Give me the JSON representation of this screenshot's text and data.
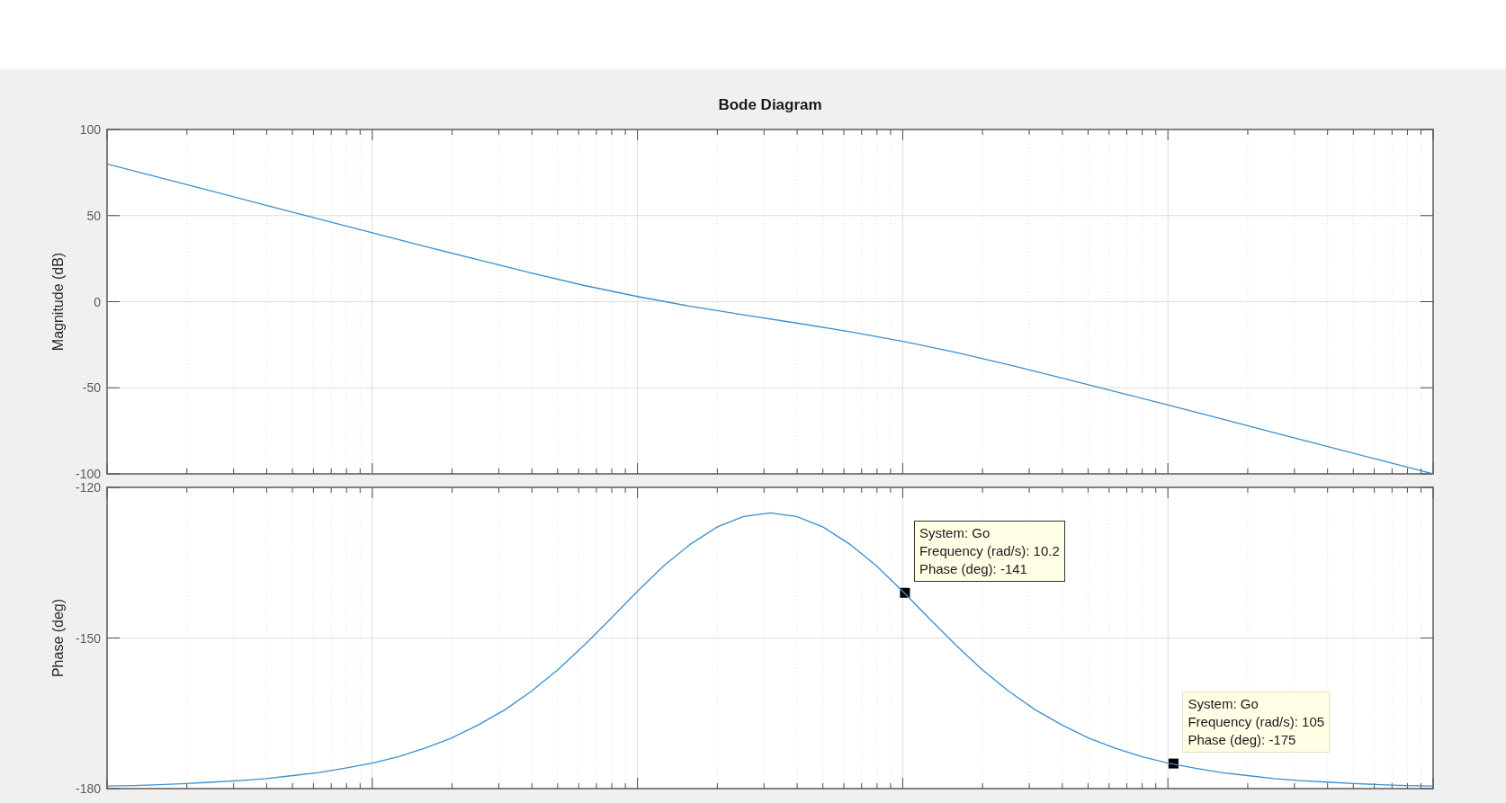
{
  "figure": {
    "title": "Bode Diagram"
  },
  "magnitude_plot": {
    "chart_data": {
      "type": "line",
      "grid": true,
      "ylabel": "Magnitude (dB)",
      "ylim": [
        -100,
        100
      ],
      "yticks": [
        -100,
        -50,
        0,
        50,
        100
      ],
      "categories": [
        null,
        null,
        null,
        null,
        null,
        null,
        null,
        null,
        null,
        null,
        null,
        null,
        null,
        null,
        null,
        null,
        null,
        null,
        null,
        null,
        null,
        null,
        null,
        null,
        null,
        null
      ],
      "series": [
        {
          "color": "#3b8fd0",
          "values": [
            80,
            72,
            64,
            56,
            48,
            40,
            32.1,
            24.3,
            16.6,
            9.4,
            3,
            -2.7,
            -7.6,
            -12.4,
            -17.4,
            -23,
            -29.4,
            -36.6,
            -44.3,
            -52.1,
            -60,
            -68,
            -76,
            -84,
            -92,
            -100
          ]
        }
      ]
    }
  },
  "phase_plot": {
    "chart_data": {
      "type": "line",
      "grid": true,
      "ylabel": "Phase (deg)",
      "ylim": [
        -180,
        -120
      ],
      "yticks": [
        -180,
        -150,
        -120
      ],
      "categories": [
        null,
        null,
        null,
        null,
        null,
        null,
        null,
        null,
        null,
        null,
        null,
        null,
        null,
        null,
        null,
        null,
        null,
        null,
        null,
        null,
        null,
        null,
        null,
        null,
        null,
        null,
        null,
        null,
        null,
        null,
        null,
        null,
        null,
        null,
        null,
        null,
        null,
        null,
        null,
        null,
        null,
        null,
        null,
        null,
        null,
        null,
        null,
        null,
        null,
        null,
        null
      ],
      "series": [
        {
          "color": "#3b8fd0",
          "values": [
            -179.5,
            -179.4,
            -179.2,
            -179,
            -178.7,
            -178.4,
            -178,
            -177.4,
            -176.8,
            -175.9,
            -174.9,
            -173.6,
            -171.9,
            -169.9,
            -167.3,
            -164.3,
            -160.6,
            -156.3,
            -151.4,
            -146.1,
            -140.7,
            -135.6,
            -131.3,
            -127.9,
            -125.8,
            -125.1,
            -125.8,
            -127.9,
            -131.3,
            -135.6,
            -140.7,
            -146.1,
            -151.4,
            -156.3,
            -160.6,
            -164.3,
            -167.3,
            -169.9,
            -171.9,
            -173.6,
            -174.9,
            -175.9,
            -176.8,
            -177.4,
            -178,
            -178.4,
            -178.7,
            -179,
            -179.2,
            -179.4,
            -179.5
          ]
        }
      ]
    },
    "datatips": [
      {
        "selected": true,
        "lines": [
          "System: Go",
          "Frequency (rad/s): 10.2",
          "Phase (deg): -141"
        ]
      },
      {
        "selected": false,
        "lines": [
          "System: Go",
          "Frequency (rad/s): 105",
          "Phase (deg): -175"
        ]
      }
    ]
  }
}
